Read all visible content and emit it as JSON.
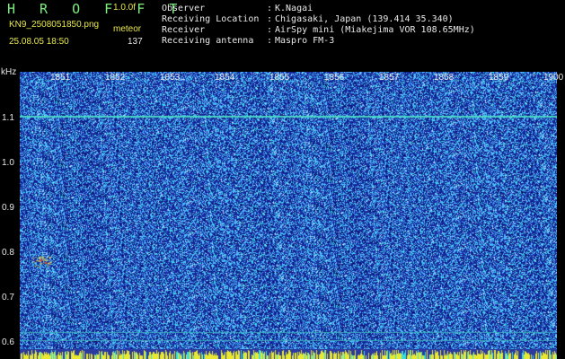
{
  "header": {
    "app_title": "H R O F F T",
    "app_version": "1.0.0f",
    "file_name": "KN9_2508051850.png",
    "meteor_label": "meteor",
    "date_time": "25.08.05 18:50",
    "meteor_count": "137"
  },
  "info": [
    {
      "key": "Observer",
      "value": "K.Nagai"
    },
    {
      "key": "Receiving Location",
      "value": "Chigasaki, Japan (139.414 35.340)"
    },
    {
      "key": "Receiver",
      "value": "AirSpy mini (Miakejima VOR 108.65MHz)"
    },
    {
      "key": "Receiving antenna",
      "value": "Maspro FM-3"
    }
  ],
  "separator": ":",
  "axis": {
    "y_unit": "kHz",
    "y_ticks": [
      "1.1",
      "1.0",
      "0.9",
      "0.8",
      "0.7",
      "0.6"
    ],
    "x_ticks": [
      "1851",
      "1852",
      "1853",
      "1854",
      "1855",
      "1856",
      "1857",
      "1858",
      "1859",
      "1900"
    ]
  },
  "colors": {
    "background": "#000000",
    "spectrogram_base": "#1a2fa8",
    "noise_light": "#4fb6ff",
    "noise_cyan": "#38e0e0",
    "carrier_line": "#4ad8c8",
    "bottom_strip": "#e8e830",
    "title_green": "#7cf07c",
    "label_yellow": "#e8e84a"
  }
}
